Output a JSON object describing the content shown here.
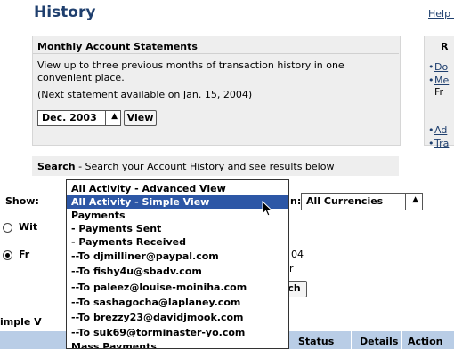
{
  "page": {
    "title": "History",
    "help_link": "Help w"
  },
  "statements": {
    "heading": "Monthly Account Statements",
    "description": "View up to three previous months of transaction history in one convenient place.",
    "next_note": "(Next statement available on Jan. 15, 2004)",
    "month_value": "Dec. 2003",
    "view_button": "View"
  },
  "right_panel": {
    "heading": "R",
    "link1": "Do",
    "link2": "Me",
    "link2_extra": "Fr",
    "link3": "Ad",
    "link4": "Tra"
  },
  "search": {
    "bold": "Search",
    "desc": " - Search your Account History and see results below"
  },
  "filters": {
    "show_label": "Show:",
    "currency_label": "n:",
    "currency_value": "All Currencies",
    "radio1_label": "Wit",
    "radio2_label": "Fr",
    "partial_date": "04",
    "partial_r": "r",
    "search_button": "ch"
  },
  "dropdown": {
    "items": [
      "All Activity - Advanced View",
      "All Activity - Simple View",
      "Payments",
      " - Payments Sent",
      " - Payments Received",
      " --To djmilliner@paypal.com",
      " --To fishy4u@sbadv.com",
      " --To paleez@louise-moiniha.com",
      " --To sashagocha@laplaney.com",
      " --To brezzy23@davidjmook.com",
      " --To suk69@torminaster-yo.com",
      "Mass Payments"
    ],
    "selected_index": 1
  },
  "results": {
    "section_label": "imple V",
    "columns": [
      "Status",
      "Details",
      "Action"
    ]
  }
}
